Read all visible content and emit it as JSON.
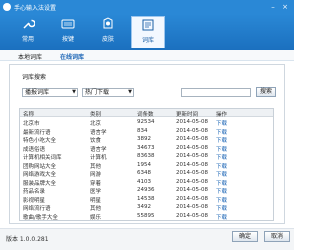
{
  "window": {
    "title": "手心输入法设置"
  },
  "tabs": [
    {
      "label": "常用",
      "icon": "wrench-icon"
    },
    {
      "label": "按键",
      "icon": "keyboard-icon"
    },
    {
      "label": "皮肤",
      "icon": "skin-icon"
    },
    {
      "label": "词库",
      "icon": "dictionary-icon"
    }
  ],
  "subnav": {
    "local": "本地词库",
    "online": "在线词库"
  },
  "search_section": {
    "label": "词库搜索",
    "category_select": "播报词库",
    "sort_select": "热门下载",
    "search_placeholder": "",
    "search_button": "搜索"
  },
  "table": {
    "columns": [
      "名称",
      "类别",
      "词条数",
      "更新时间",
      "操作"
    ],
    "rows": [
      [
        "北京市",
        "北京",
        "92534",
        "2014-05-08",
        "下载"
      ],
      [
        "最新流行语",
        "语言学",
        "834",
        "2014-05-08",
        "下载"
      ],
      [
        "特色小吃大全",
        "饮食",
        "3892",
        "2014-05-08",
        "下载"
      ],
      [
        "成语俗语",
        "语言学",
        "34673",
        "2014-05-08",
        "下载"
      ],
      [
        "计算机相关词库",
        "计算机",
        "83638",
        "2014-05-08",
        "下载"
      ],
      [
        "团购网站大全",
        "其他",
        "1954",
        "2014-05-08",
        "下载"
      ],
      [
        "网络游戏大全",
        "网游",
        "6348",
        "2014-05-08",
        "下载"
      ],
      [
        "服装品牌大全",
        "穿着",
        "4103",
        "2014-05-08",
        "下载"
      ],
      [
        "药品名录",
        "医学",
        "24936",
        "2014-05-08",
        "下载"
      ],
      [
        "影视明星",
        "明星",
        "14538",
        "2014-05-08",
        "下载"
      ],
      [
        "网络流行语",
        "其他",
        "3492",
        "2014-05-08",
        "下载"
      ],
      [
        "歌曲/歌手大全",
        "娱乐",
        "55895",
        "2014-05-08",
        "下载"
      ]
    ]
  },
  "footer": {
    "version": "版本 1.0.0.281",
    "ok": "确定",
    "cancel": "取消"
  },
  "colors": {
    "accent": "#2a88d6",
    "link": "#1a64b5"
  }
}
